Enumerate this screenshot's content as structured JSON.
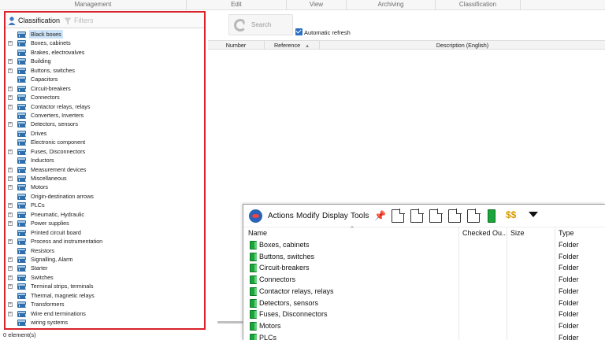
{
  "ribbon": {
    "groups": [
      "Management",
      "Edit",
      "View",
      "Archiving",
      "Classification"
    ]
  },
  "left_panel": {
    "tab_classification": "Classification",
    "tab_filters": "Filters",
    "tree": [
      {
        "label": "Black boxes",
        "expandable": false,
        "selected": true
      },
      {
        "label": "Boxes, cabinets",
        "expandable": true
      },
      {
        "label": "Brakes, electrovalves",
        "expandable": false
      },
      {
        "label": "Building",
        "expandable": true
      },
      {
        "label": "Buttons, switches",
        "expandable": true
      },
      {
        "label": "Capacitors",
        "expandable": false
      },
      {
        "label": "Circuit-breakers",
        "expandable": true
      },
      {
        "label": "Connectors",
        "expandable": true
      },
      {
        "label": "Contactor relays, relays",
        "expandable": true
      },
      {
        "label": "Converters, Inverters",
        "expandable": false
      },
      {
        "label": "Detectors, sensors",
        "expandable": true
      },
      {
        "label": "Drives",
        "expandable": false
      },
      {
        "label": "Electronic component",
        "expandable": false
      },
      {
        "label": "Fuses, Disconnectors",
        "expandable": true
      },
      {
        "label": "Inductors",
        "expandable": false
      },
      {
        "label": "Measurement devices",
        "expandable": true
      },
      {
        "label": "Miscellaneous",
        "expandable": true
      },
      {
        "label": "Motors",
        "expandable": true
      },
      {
        "label": "Origin-destination arrows",
        "expandable": false
      },
      {
        "label": "PLCs",
        "expandable": true
      },
      {
        "label": "Pneumatic, Hydraulic",
        "expandable": true
      },
      {
        "label": "Power supplies",
        "expandable": true
      },
      {
        "label": "Printed circuit board",
        "expandable": false
      },
      {
        "label": "Process and instrumentation",
        "expandable": true
      },
      {
        "label": "Resistors",
        "expandable": false
      },
      {
        "label": "Signalling, Alarm",
        "expandable": true
      },
      {
        "label": "Starter",
        "expandable": true
      },
      {
        "label": "Switches",
        "expandable": true
      },
      {
        "label": "Terminal strips, terminals",
        "expandable": true
      },
      {
        "label": "Thermal, magnetic relays",
        "expandable": false
      },
      {
        "label": "Transformers",
        "expandable": true
      },
      {
        "label": "Wire end terminations",
        "expandable": true
      },
      {
        "label": "wiring systems",
        "expandable": false
      }
    ]
  },
  "status": "0 element(s)",
  "search": {
    "button_label": "Search",
    "auto_refresh_label": "Automatic refresh",
    "auto_refresh_checked": true
  },
  "grid": {
    "columns": [
      "Number",
      "Reference",
      "Description (English)"
    ]
  },
  "explorer": {
    "menu": [
      "Actions",
      "Modify",
      "Display",
      "Tools"
    ],
    "columns": [
      "Name",
      "Checked Ou...",
      "Size",
      "Type"
    ],
    "rows": [
      {
        "name": "Boxes, cabinets",
        "type": "Folder"
      },
      {
        "name": "Buttons, switches",
        "type": "Folder"
      },
      {
        "name": "Circuit-breakers",
        "type": "Folder"
      },
      {
        "name": "Connectors",
        "type": "Folder"
      },
      {
        "name": "Contactor relays, relays",
        "type": "Folder"
      },
      {
        "name": "Detectors, sensors",
        "type": "Folder"
      },
      {
        "name": "Fuses, Disconnectors",
        "type": "Folder"
      },
      {
        "name": "Motors",
        "type": "Folder"
      },
      {
        "name": "PLCs",
        "type": "Folder"
      }
    ]
  },
  "colors": {
    "highlight_border": "#d9232a",
    "folder_blue": "#2f6ea8",
    "folder_green": "#1aa53a",
    "checkbox_blue": "#2b6fc2"
  }
}
